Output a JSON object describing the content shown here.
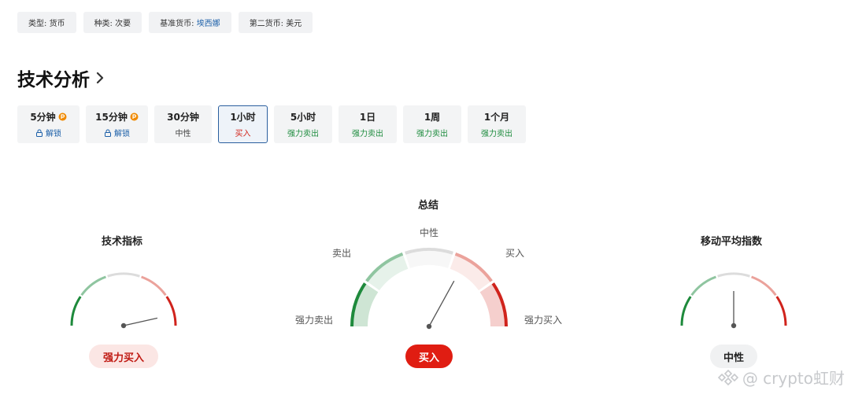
{
  "tags": [
    {
      "label": "类型:",
      "value": "货币",
      "link": false
    },
    {
      "label": "种类:",
      "value": "次要",
      "link": false
    },
    {
      "label": "基准货币:",
      "value": "埃西娜",
      "link": true
    },
    {
      "label": "第二货币:",
      "value": "美元",
      "link": false
    }
  ],
  "section_title": "技术分析",
  "tabs": [
    {
      "label": "5分钟",
      "pro": true,
      "sub": "解锁",
      "sub_type": "unlock",
      "active": false
    },
    {
      "label": "15分钟",
      "pro": true,
      "sub": "解锁",
      "sub_type": "unlock",
      "active": false
    },
    {
      "label": "30分钟",
      "pro": false,
      "sub": "中性",
      "sub_type": "neutral",
      "active": false
    },
    {
      "label": "1小时",
      "pro": false,
      "sub": "买入",
      "sub_type": "buy",
      "active": true
    },
    {
      "label": "5小时",
      "pro": false,
      "sub": "强力卖出",
      "sub_type": "sell",
      "active": false
    },
    {
      "label": "1日",
      "pro": false,
      "sub": "强力卖出",
      "sub_type": "sell",
      "active": false
    },
    {
      "label": "1周",
      "pro": false,
      "sub": "强力卖出",
      "sub_type": "sell",
      "active": false
    },
    {
      "label": "1个月",
      "pro": false,
      "sub": "强力卖出",
      "sub_type": "sell",
      "active": false
    }
  ],
  "gauges": {
    "technical": {
      "title": "技术指标",
      "result": "强力买入",
      "needle_fraction": 0.93
    },
    "summary": {
      "title": "总结",
      "result": "买入",
      "needle_fraction": 0.66,
      "labels": {
        "strong_sell": "强力卖出",
        "sell": "卖出",
        "neutral": "中性",
        "buy": "买入",
        "strong_buy": "强力买入"
      }
    },
    "moving_averages": {
      "title": "移动平均指数",
      "result": "中性",
      "needle_fraction": 0.5
    }
  },
  "colors": {
    "strong_sell": "#1e8a3c",
    "sell": "#8fc5a0",
    "neutral": "#dcdcdc",
    "buy": "#eba29b",
    "strong_buy": "#d0231c",
    "link": "#1b5fa8",
    "pro": "#f08a00"
  },
  "watermark": "@ crypto虹财"
}
